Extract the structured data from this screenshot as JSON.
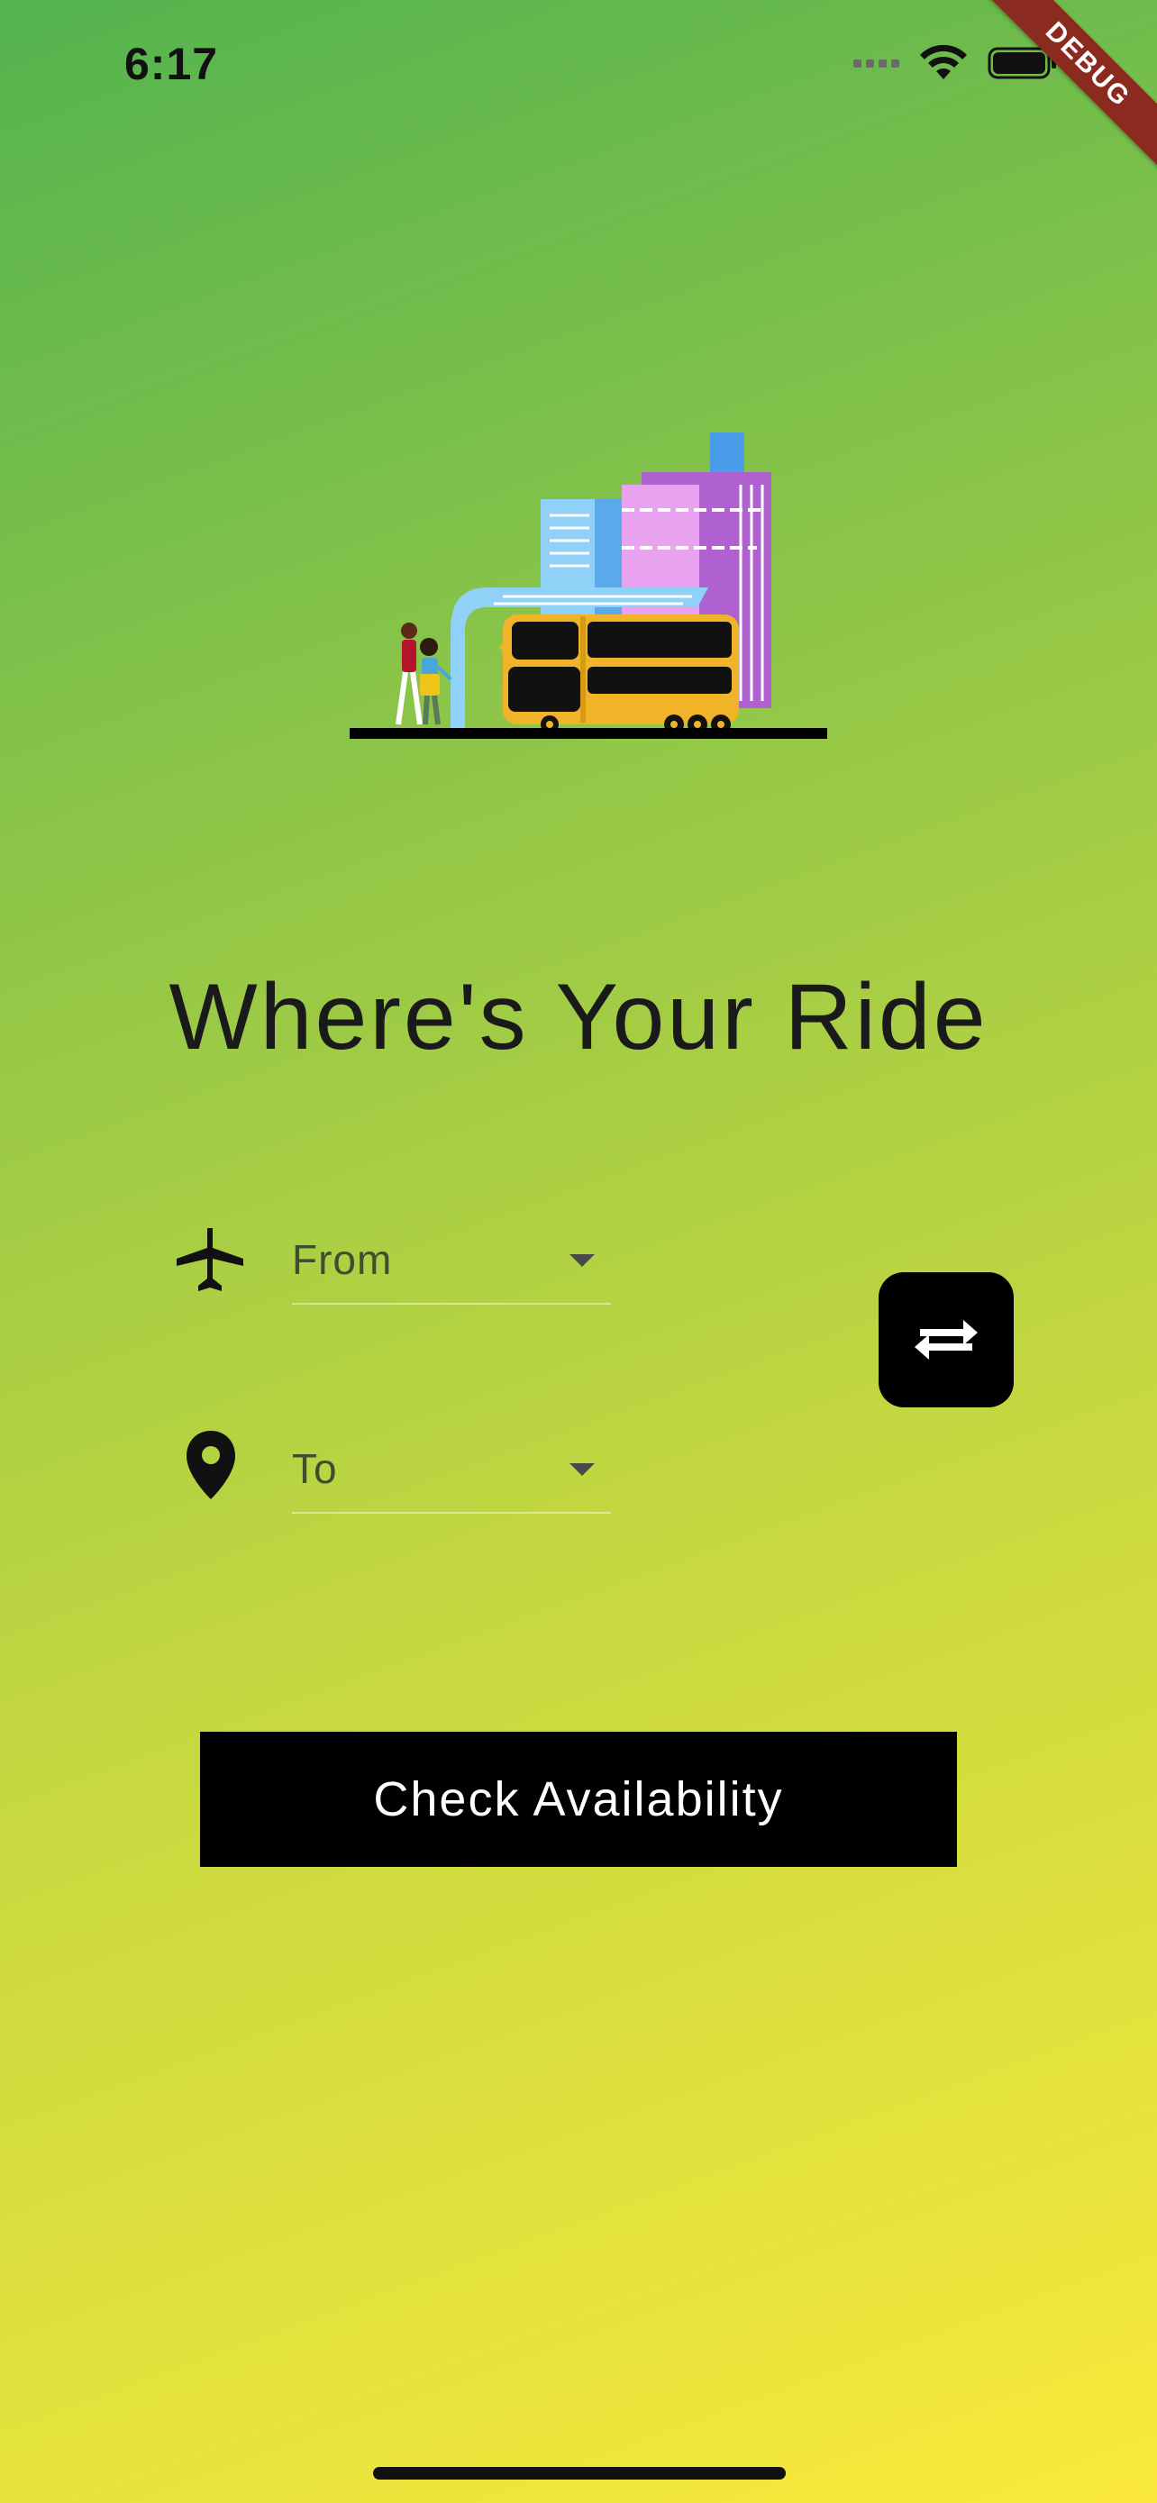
{
  "status_bar": {
    "time": "6:17"
  },
  "debug_banner": "DEBUG",
  "title": "Where's Your Ride",
  "form": {
    "from": {
      "placeholder": "From",
      "icon": "airplane-icon"
    },
    "to": {
      "placeholder": "To",
      "icon": "location-pin-icon"
    },
    "swap_icon": "swap-arrows-icon"
  },
  "check_button": {
    "label": "Check Availability"
  },
  "colors": {
    "gradient_top": "#54b34f",
    "gradient_bottom": "#fae93b",
    "button": "#000000",
    "button_text": "#ffffff",
    "ribbon": "#8b2a1e"
  }
}
